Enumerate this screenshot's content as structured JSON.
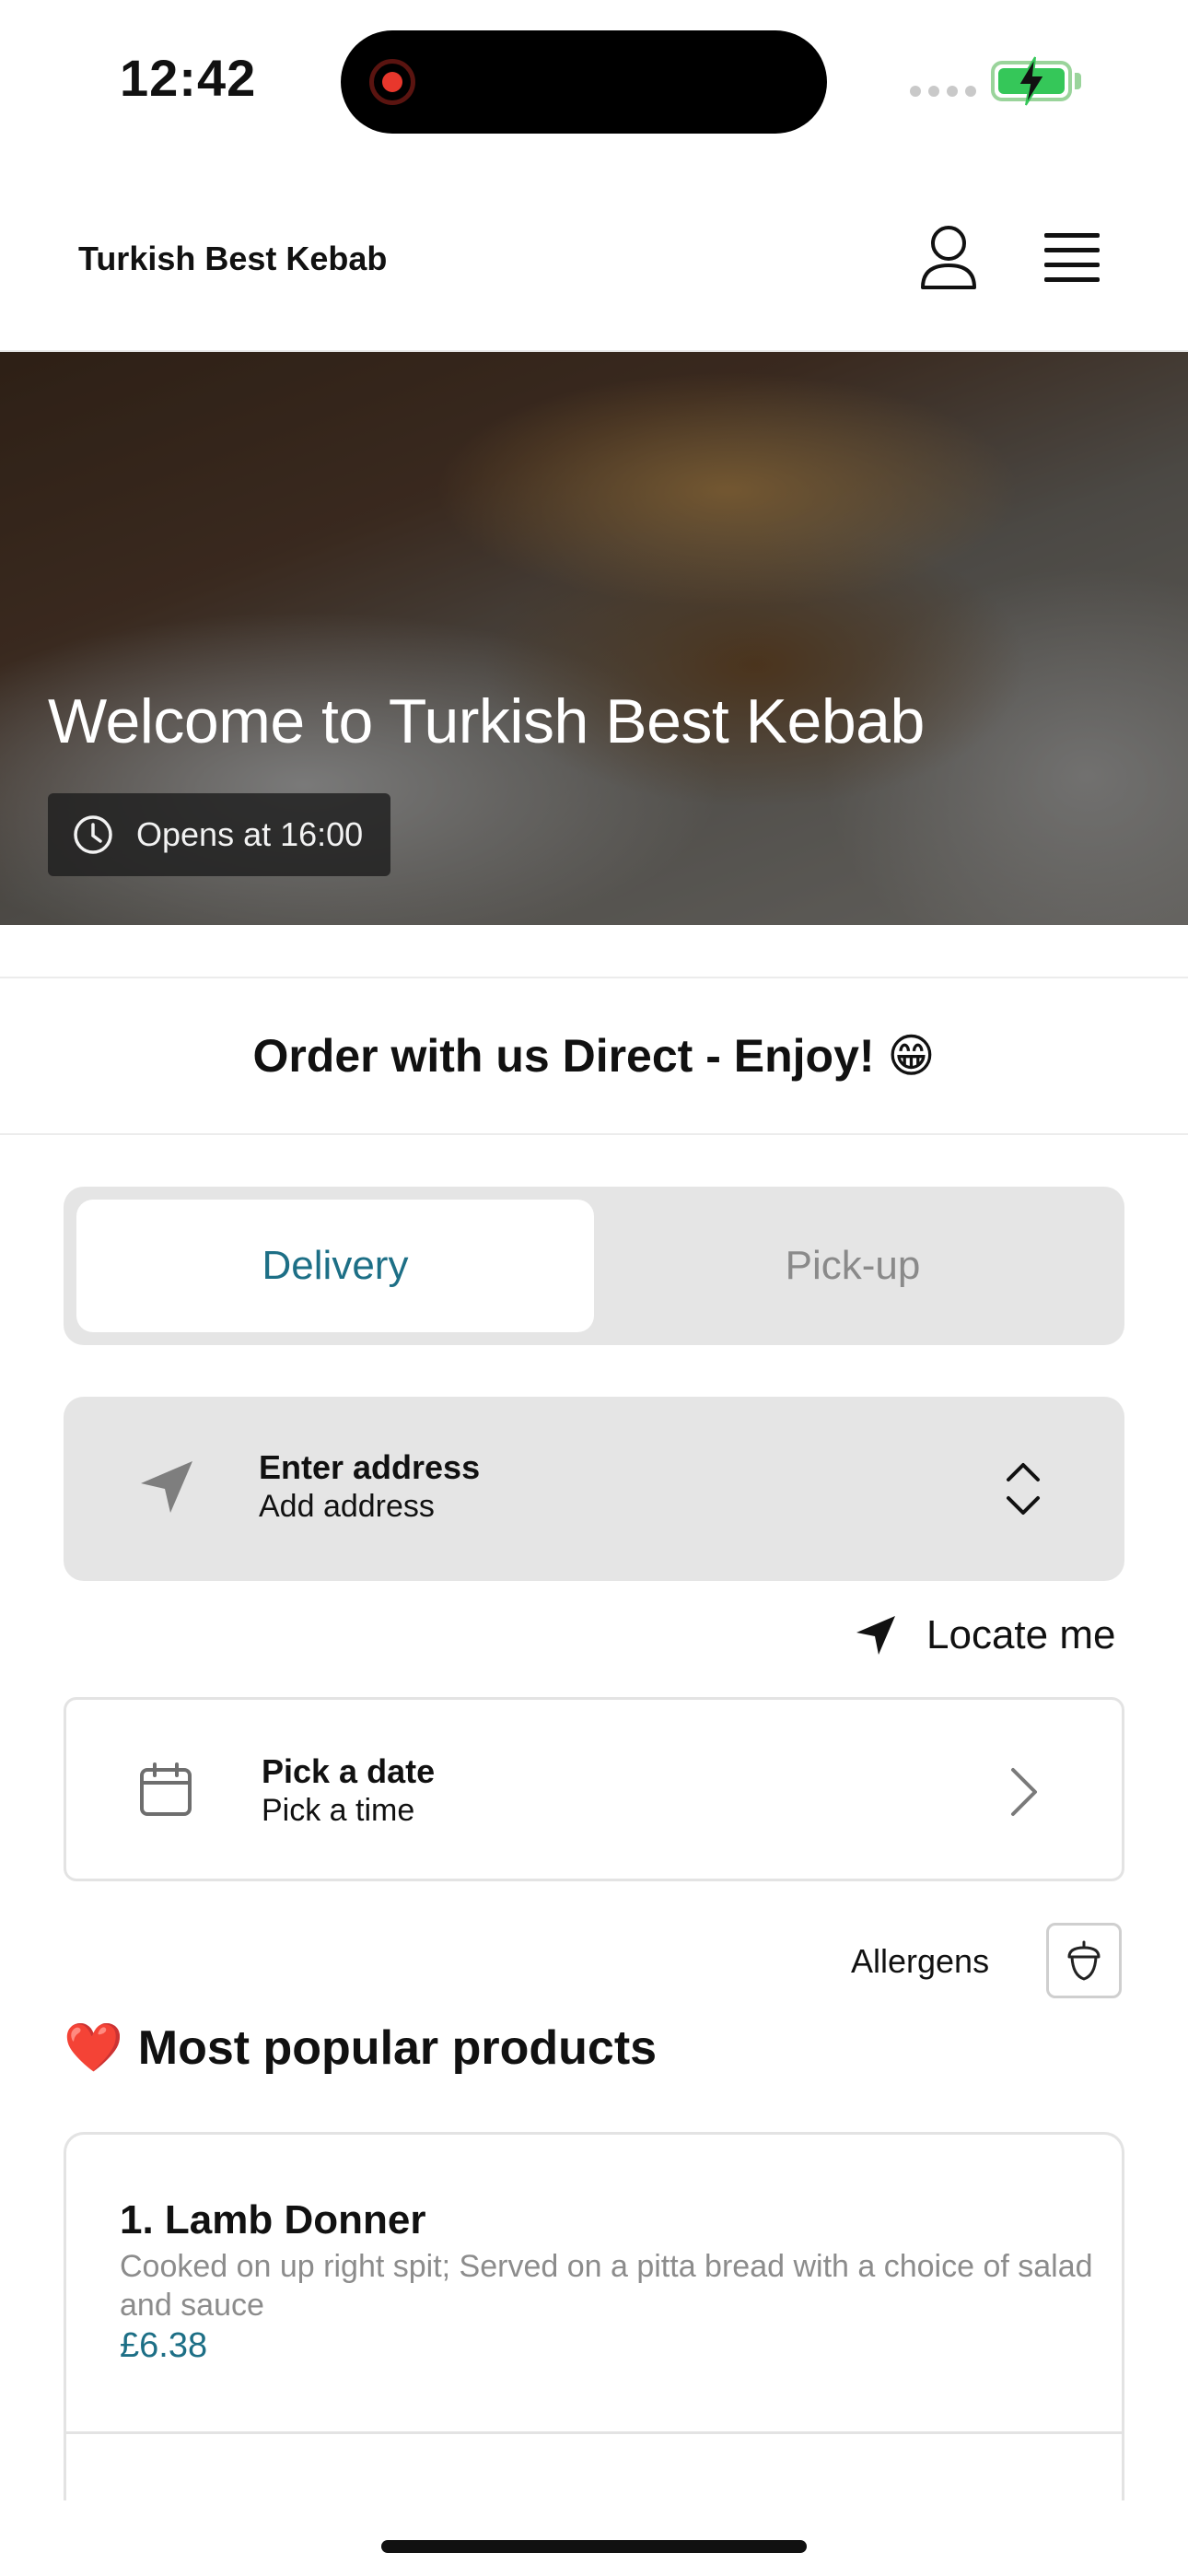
{
  "status_bar": {
    "time": "12:42",
    "battery_color": "#35c759",
    "recording_color": "#e8372c"
  },
  "header": {
    "brand": "Turkish Best Kebab",
    "icons": [
      "user-icon",
      "hamburger-menu-icon"
    ]
  },
  "hero": {
    "title": "Welcome to Turkish Best Kebab",
    "hours": "Opens at 16:00",
    "hours_icon": "clock-icon"
  },
  "promo": {
    "text": "Order with us Direct - Enjoy! 😁"
  },
  "order_type": {
    "tabs": [
      {
        "label": "Delivery",
        "selected": true
      },
      {
        "label": "Pick-up",
        "selected": false
      }
    ],
    "accent": "#1d6f86"
  },
  "address": {
    "title": "Enter address",
    "subtitle": "Add address",
    "icon": "navigation-arrow-icon"
  },
  "locate": {
    "label": "Locate me",
    "icon": "location-arrow-icon"
  },
  "schedule": {
    "title": "Pick a date",
    "subtitle": "Pick a time",
    "icon": "calendar-icon"
  },
  "allergens": {
    "label": "Allergens",
    "icon": "acorn-icon"
  },
  "popular": {
    "heading": "Most popular products",
    "heading_icon": "heart-icon",
    "products": [
      {
        "name": "1. Lamb Donner",
        "description": "Cooked on up right spit; Served on a pitta bread with a choice of salad and sauce",
        "price": "£6.38"
      }
    ]
  }
}
